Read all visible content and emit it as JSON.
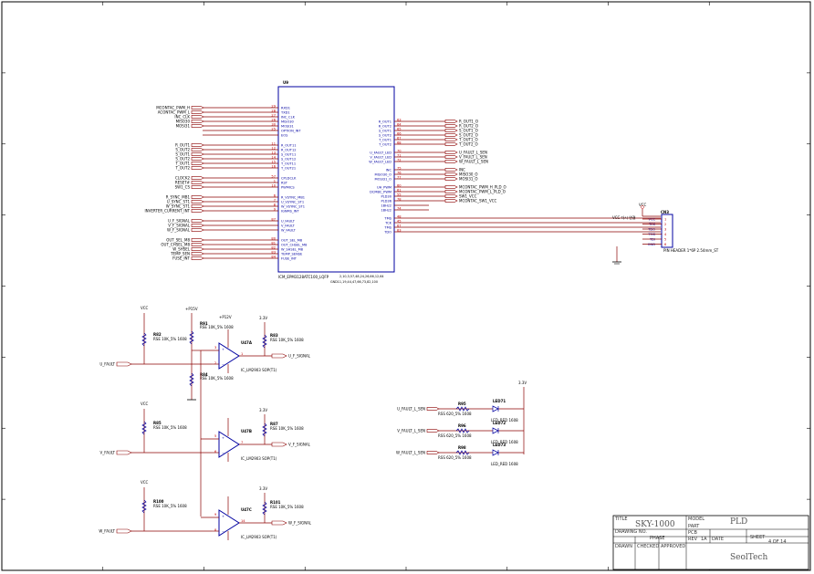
{
  "u9": {
    "ref": "U9",
    "part": "ICM_EPM3128ATC100_LQFP",
    "power_note_1": "2,10,3,57,48,24,26,66,12,64",
    "power_note_2": "GND11,19,44,47,66,73,82,100",
    "left_pins": [
      {
        "net": "MCONTAC_PWM_H",
        "num": "29",
        "name": "RXD1"
      },
      {
        "net": "ACONTAC_PWM_L",
        "num": "28",
        "name": "TXD1"
      },
      {
        "net": "INC_CLK",
        "num": "27",
        "name": "INC_CLK"
      },
      {
        "net": "MISO30",
        "num": "26",
        "name": "MISO30"
      },
      {
        "net": "MOSI31",
        "num": "30",
        "name": "MOSI31"
      },
      {
        "net": "",
        "num": "25",
        "name": "OPTION_INT"
      },
      {
        "net": "",
        "num": "",
        "name": "EOS"
      },
      {
        "net": "R_OUT1",
        "num": "11",
        "name": "R_OUT11"
      },
      {
        "net": "S_OUT2",
        "num": "12",
        "name": "R_OUT12"
      },
      {
        "net": "S_OUT1",
        "num": "13",
        "name": "S_OUT11"
      },
      {
        "net": "S_OUT2",
        "num": "14",
        "name": "S_OUT12"
      },
      {
        "net": "T_OUT1",
        "num": "15",
        "name": "T_OUT11"
      },
      {
        "net": "T_OUT2",
        "num": "16",
        "name": "T_OUT21"
      },
      {
        "net": "CLOCK2",
        "num": "57",
        "name": "CPLDCLK"
      },
      {
        "net": "RESET#",
        "num": "1",
        "name": "RST"
      },
      {
        "net": "SW1_CS",
        "num": "10",
        "name": "PWMICS"
      },
      {
        "net": "R_SYNC_MB1",
        "num": "6",
        "name": "R_VSYNC_MB1"
      },
      {
        "net": "U_SYNC_ST1",
        "num": "7",
        "name": "U_VSYNC_ST1"
      },
      {
        "net": "W_SYNC_ST1",
        "num": "8",
        "name": "W_VSYNC_ST1"
      },
      {
        "net": "INVERTER_CURRENT_INT",
        "num": "9",
        "name": "IGNMS_INT"
      },
      {
        "net": "U_F_SIGNAL",
        "num": "87",
        "name": "U_FAULT"
      },
      {
        "net": "V_F_SIGNAL",
        "num": "",
        "name": "V_FAULT"
      },
      {
        "net": "W_F_SIGNAL",
        "num": "",
        "name": "W_FAULT"
      },
      {
        "net": "OUT_SEL_M8",
        "num": "80",
        "name": "OUT_SEL_M8"
      },
      {
        "net": "OUT_CHSEL_M8",
        "num": "81",
        "name": "OUT_CHSEL_M8"
      },
      {
        "net": "W_SHSEL",
        "num": "82",
        "name": "W_SHSEL_M8"
      },
      {
        "net": "TEMP_SEN",
        "num": "83",
        "name": "TEMP_SENSE"
      },
      {
        "net": "FUSE_INT",
        "num": "84",
        "name": "FUSE_INT"
      }
    ],
    "right_pins": [
      {
        "name": "R_OUT1",
        "num": "63",
        "net": "R_OUT1_O"
      },
      {
        "name": "R_OUT2",
        "num": "64",
        "net": "R_OUT2_O"
      },
      {
        "name": "S_OUT1",
        "num": "65",
        "net": "S_OUT1_O"
      },
      {
        "name": "S_OUT2",
        "num": "66",
        "net": "S_OUT2_O"
      },
      {
        "name": "T_OUT1",
        "num": "67",
        "net": "T_OUT1_O"
      },
      {
        "name": "T_OUT2",
        "num": "68",
        "net": "T_OUT2_O"
      },
      {
        "name": "U_FAULT_LED",
        "num": "70",
        "net": "U_FAULT_L_SEN"
      },
      {
        "name": "V_FAULT_LED",
        "num": "71",
        "net": "V_FAULT_L_SEN"
      },
      {
        "name": "W_FAULT_LED",
        "num": "72",
        "net": "W_FAULT_L_SEN"
      },
      {
        "name": "INC",
        "num": "75",
        "net": "INC"
      },
      {
        "name": "MISO30_O",
        "num": "76",
        "net": "MISO30_O"
      },
      {
        "name": "MOSI31_O",
        "num": "77",
        "net": "MOSI31_O"
      },
      {
        "name": "UH_PWM",
        "num": "60",
        "net": "MCONTAC_PWM_H_PLD_O"
      },
      {
        "name": "DCMBC_PWM",
        "num": "61",
        "net": "MCONTAC_PWM_L_PLD_O"
      },
      {
        "name": "PLD30",
        "num": "55",
        "net": "SW1_VCC"
      },
      {
        "name": "PLD36",
        "num": "78",
        "net": "MCONTAC_SW1_VCC"
      },
      {
        "name": "1BHz2",
        "num": "",
        "net": ""
      },
      {
        "name": "1BHz2",
        "num": "74",
        "net": ""
      },
      {
        "name": "TMS",
        "num": "48",
        "net": ""
      },
      {
        "name": "TCK",
        "num": "45",
        "net": ""
      },
      {
        "name": "TMS",
        "num": "67",
        "net": ""
      },
      {
        "name": "TDO",
        "num": "83",
        "net": ""
      }
    ]
  },
  "jtag": {
    "ref": "CN3",
    "vcc": "VCC",
    "note": "VCC 다시 연결",
    "part": "PIN HEADER 1*6P 2.54mm_ST",
    "pins": [
      "1",
      "2",
      "3",
      "4",
      "5",
      "6"
    ],
    "pin_names": [
      "VCC",
      "TCK",
      "TDO",
      "TMS",
      "TDI",
      "GND"
    ]
  },
  "opamps": [
    {
      "ref": "U47A",
      "part": "IC_LM2903 SOP(T1)",
      "input": "U_FAULT",
      "output": "U_F_SIGNAL",
      "ra": "R82",
      "rb": "R91",
      "rc": "R84",
      "rd": "R83",
      "rval": "RSE 10K_5% 1608",
      "supply": "VCC",
      "vref": "+P15V",
      "pullup": "3.3V",
      "pin_p": "3",
      "pin_n": "2",
      "pin_o": "1"
    },
    {
      "ref": "U47B",
      "part": "IC_LM2903 SOP(T1)",
      "input": "V_FAULT",
      "output": "V_F_SIGNAL",
      "ra": "R85",
      "rb": "",
      "rc": "",
      "rd": "R87",
      "rval": "RSE 10K_5% 1608",
      "supply": "VCC",
      "vref": "",
      "pullup": "3.3V",
      "pin_p": "5",
      "pin_n": "6",
      "pin_o": "7"
    },
    {
      "ref": "U47C",
      "part": "IC_LM2903 SOP(T1)",
      "input": "W_FAULT",
      "output": "W_F_SIGNAL",
      "ra": "R100",
      "rb": "",
      "rc": "",
      "rd": "R101",
      "rval": "RSE 10K_5% 1608",
      "supply": "VCC",
      "vref": "",
      "pullup": "3.3V",
      "pin_p": "9",
      "pin_n": "8",
      "pin_o": "14"
    }
  ],
  "pwr_labels": {
    "vcc": "VCC",
    "p15": "+P15V",
    "p12": "+P12V",
    "v33": "3.3V"
  },
  "leds": {
    "supply": "3.3V",
    "rows": [
      {
        "net": "U_FAULT_L_SEN",
        "r": "R95",
        "rval": "RSS 620_5% 1608",
        "led": "LED71",
        "lval": "LED_RED 1608"
      },
      {
        "net": "V_FAULT_L_SEN",
        "r": "R96",
        "rval": "RSS 620_5% 1608",
        "led": "LED72",
        "lval": "LED_RED 1608"
      },
      {
        "net": "W_FAULT_L_SEN",
        "r": "R98",
        "rval": "RSS 620_5% 1608",
        "led": "LED73",
        "lval": "LED_RED 1608"
      }
    ]
  },
  "title_block": {
    "title_lbl": "TITLE",
    "title": "SKY-1000",
    "model_lbl": "MODEL",
    "model": "PLD",
    "drawing_lbl": "DRAWING NO.",
    "phase": "PHASE",
    "part_lbl": "PART",
    "part": "PCB",
    "rev_lbl": "REV",
    "rev": "1A",
    "date_lbl": "DATE",
    "sheet_lbl": "SHEET",
    "sheet": "4 OF 14",
    "drawn_lbl": "DRAWN",
    "checked_lbl": "CHECKED",
    "approved_lbl": "APPROVED",
    "company": "SeolTech"
  }
}
